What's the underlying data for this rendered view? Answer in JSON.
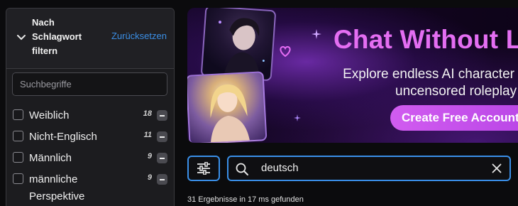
{
  "sidebar": {
    "title": "Nach Schlagwort filtern",
    "reset_label": "Zurücksetzen",
    "search_placeholder": "Suchbegriffe",
    "tags": [
      {
        "label": "Weiblich",
        "count": "18"
      },
      {
        "label": "Nicht-Englisch",
        "count": "11"
      },
      {
        "label": "Männlich",
        "count": "9"
      },
      {
        "label": "männliche Perspektive",
        "count": "9"
      }
    ]
  },
  "banner": {
    "title": "Chat Without L",
    "subtitle_line1": "Explore endless AI character",
    "subtitle_line2": "uncensored roleplay",
    "cta_label": "Create Free Account"
  },
  "search": {
    "value": "deutsch"
  },
  "results_text": "31 Ergebnisse in 17 ms gefunden",
  "colors": {
    "accent": "#3a8fe8",
    "banner_title": "#e46ef2",
    "cta": "#c452ec"
  },
  "icons": [
    "chevron-down-icon",
    "sliders-icon",
    "search-icon",
    "close-icon",
    "minus-icon",
    "heart-icon",
    "sparkle-icon"
  ]
}
